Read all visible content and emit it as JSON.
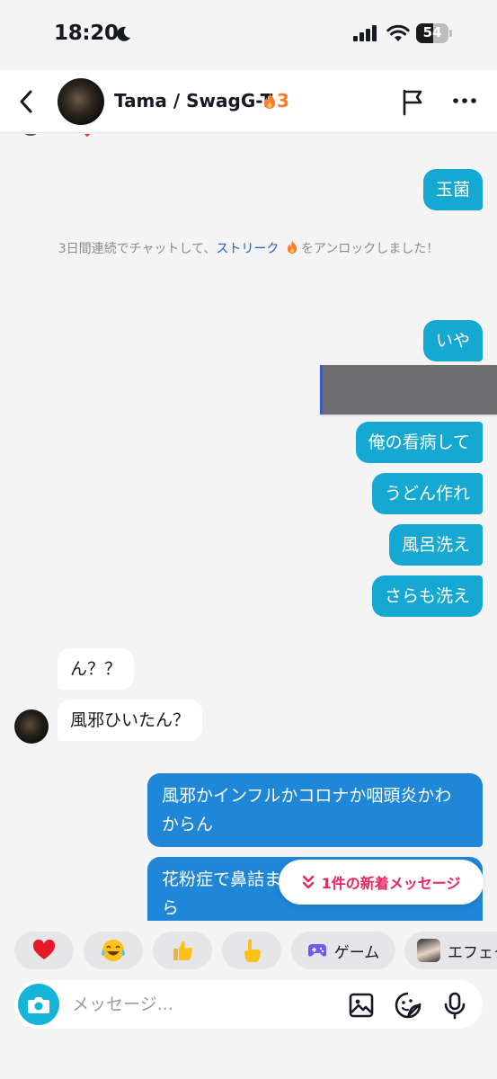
{
  "status_bar": {
    "time": "18:20",
    "battery": "54",
    "battery_level": 0.54
  },
  "header": {
    "name": "Tama / SwagG-T",
    "streak_count": "3"
  },
  "chat": {
    "m1": "玉菌",
    "system_before": "3日間連続でチャットして、",
    "system_link": "ストリーク",
    "system_after": "をアンロックしました！",
    "m2": "いや",
    "m3": "俺の看病して",
    "m4": "うどん作れ",
    "m5": "風呂洗え",
    "m6": "さらも洗え",
    "r1": "ん？？",
    "r2": "風邪ひいたん？",
    "m7": "風邪かインフルかコロナか咽頭炎かわからん",
    "m8": "花粉症で鼻詰まってる",
    "m8_tail": "ら"
  },
  "new_message_pill": "1件の新着メッセージ",
  "quick_bar": {
    "game": "ゲーム",
    "effect": "エフェクト"
  },
  "input": {
    "placeholder": "メッセージ..."
  },
  "colors": {
    "my_bubble": "#14a8d2",
    "my_bubble_latest": "#1f86d8",
    "accent_pink": "#e8265e",
    "streak_orange": "#fe7a2a"
  }
}
